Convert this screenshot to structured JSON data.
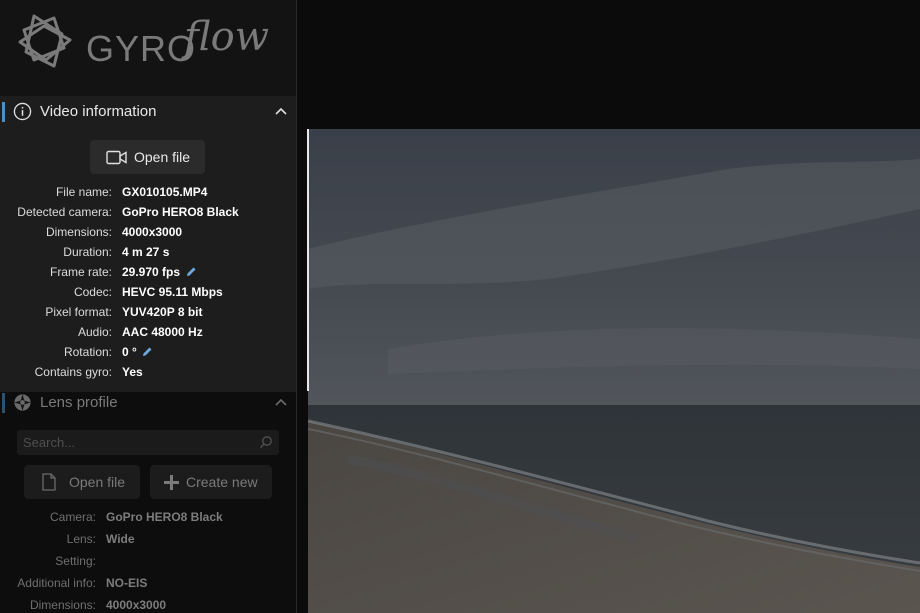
{
  "app": {
    "logo_text": "GYRO",
    "logo_flow": "flow"
  },
  "video_info": {
    "title": "Video information",
    "open_file_label": "Open file",
    "rows": [
      {
        "key": "File name:",
        "value": "GX010105.MP4"
      },
      {
        "key": "Detected camera:",
        "value": "GoPro HERO8 Black"
      },
      {
        "key": "Dimensions:",
        "value": "4000x3000"
      },
      {
        "key": "Duration:",
        "value": "4 m 27 s"
      },
      {
        "key": "Frame rate:",
        "value": "29.970 fps"
      },
      {
        "key": "Codec:",
        "value": "HEVC 95.11 Mbps"
      },
      {
        "key": "Pixel format:",
        "value": "YUV420P 8 bit"
      },
      {
        "key": "Audio:",
        "value": "AAC 48000 Hz"
      },
      {
        "key": "Rotation:",
        "value": "0 °"
      },
      {
        "key": "Contains gyro:",
        "value": "Yes"
      }
    ]
  },
  "lens_profile": {
    "title": "Lens profile",
    "search_placeholder": "Search...",
    "open_file_label": "Open file",
    "create_new_label": "Create new",
    "rows": [
      {
        "key": "Camera:",
        "value": "GoPro HERO8 Black"
      },
      {
        "key": "Lens:",
        "value": "Wide"
      },
      {
        "key": "Setting:",
        "value": ""
      },
      {
        "key": "Additional info:",
        "value": "NO-EIS"
      },
      {
        "key": "Dimensions:",
        "value": "4000x3000"
      }
    ]
  },
  "colors": {
    "accent": "#4a90c8",
    "pen": "#6fa8dc"
  }
}
